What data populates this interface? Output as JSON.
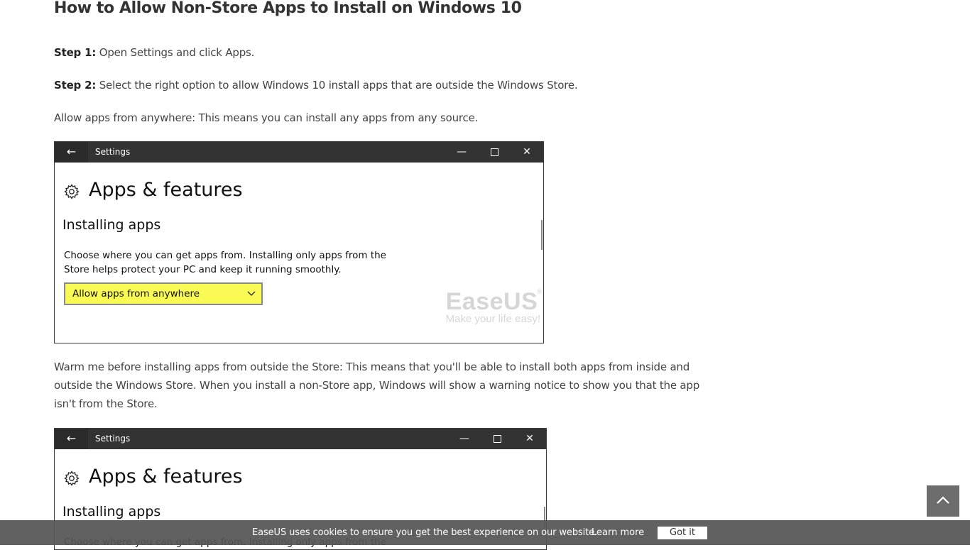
{
  "article": {
    "heading": "How to Allow Non-Store Apps to Install on Windows 10",
    "step1_label": "Step 1:",
    "step1_text": " Open Settings and click Apps.",
    "step2_label": "Step 2:",
    "step2_text": " Select the right option to allow Windows 10 install apps that are outside the Windows Store.",
    "option1_text": "Allow apps from anywhere: This means you can install any apps from any source.",
    "option2_text": "Warm me before installing apps from outside the Store: This means that you'll be able to install both apps from inside and outside the Windows Store. When you install a non-Store app, Windows will show a warning notice to show you that the app isn't from the Store."
  },
  "screenshot1": {
    "window_title": "Settings",
    "back_icon": "back-arrow-icon",
    "page_title": "Apps & features",
    "section_title": "Installing apps",
    "description": "Choose where you can get apps from. Installing only apps from the Store helps protect your PC and keep it running smoothly.",
    "dropdown_value": "Allow apps from anywhere",
    "dropdown_bg": "#fafa54",
    "watermark_logo": "EaseUS",
    "watermark_tagline": "Make your life easy!",
    "watermark_reg": "®"
  },
  "screenshot2": {
    "window_title": "Settings",
    "page_title": "Apps & features",
    "section_title": "Installing apps",
    "description": "Choose where you can get apps from. Installing only apps from the"
  },
  "cookie_bar": {
    "message": "EaseUS uses cookies to ensure you get the best experience on our website.",
    "learn_more": "Learn more",
    "accept": "Got it"
  },
  "back_to_top_icon": "chevron-up-icon",
  "colors": {
    "titlebar": "#333333",
    "cookie_bar": "#555555",
    "back_to_top": "#6d6d6d"
  }
}
